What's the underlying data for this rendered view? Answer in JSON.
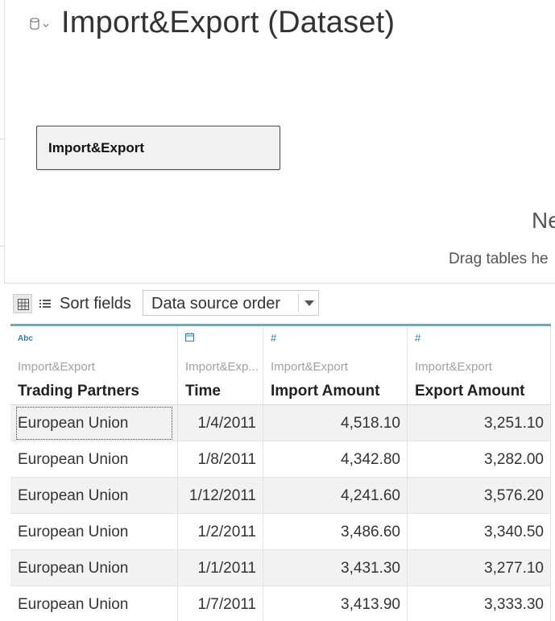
{
  "datasource": {
    "icon": "database-dropdown-icon",
    "title": "Import&Export (Dataset)"
  },
  "canvas": {
    "table_card_label": "Import&Export",
    "empty_heading": "Ne",
    "empty_hint": "Drag tables he"
  },
  "toolbar": {
    "grid_view_icon": "grid-view-icon",
    "list_view_icon": "list-view-icon",
    "sort_label": "Sort fields",
    "sort_value": "Data source order"
  },
  "grid": {
    "columns": [
      {
        "type_icon": "Abc",
        "source": "Import&Export",
        "name": "Trading Partners"
      },
      {
        "type_icon": "calendar-icon",
        "source": "Import&Exp...",
        "name": "Time"
      },
      {
        "type_icon": "#",
        "source": "Import&Export",
        "name": "Import Amount"
      },
      {
        "type_icon": "#",
        "source": "Import&Export",
        "name": "Export Amount"
      }
    ],
    "rows": [
      [
        "European Union",
        "1/4/2011",
        "4,518.10",
        "3,251.10"
      ],
      [
        "European Union",
        "1/8/2011",
        "4,342.80",
        "3,282.00"
      ],
      [
        "European Union",
        "1/12/2011",
        "4,241.60",
        "3,576.20"
      ],
      [
        "European Union",
        "1/2/2011",
        "3,486.60",
        "3,340.50"
      ],
      [
        "European Union",
        "1/1/2011",
        "3,431.30",
        "3,277.10"
      ],
      [
        "European Union",
        "1/7/2011",
        "3,413.90",
        "3,333.30"
      ]
    ]
  },
  "colors": {
    "header_accent": "#6fa7c4",
    "type_icon": "#2f7ea8"
  }
}
